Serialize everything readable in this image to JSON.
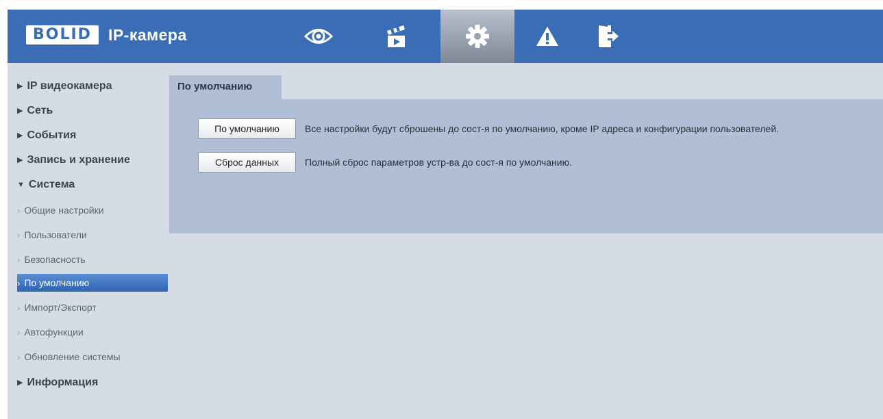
{
  "header": {
    "brand": "BOLID",
    "product": "IP-камера",
    "toolbar": [
      {
        "icon": "eye-icon",
        "active": false
      },
      {
        "icon": "clapperboard-icon",
        "active": false
      },
      {
        "icon": "gear-icon",
        "active": true
      },
      {
        "icon": "warning-icon",
        "active": false
      },
      {
        "icon": "logout-icon",
        "active": false
      }
    ]
  },
  "sidebar": {
    "items": [
      {
        "label": "IP видеокамера",
        "expanded": false
      },
      {
        "label": "Сеть",
        "expanded": false
      },
      {
        "label": "События",
        "expanded": false
      },
      {
        "label": "Запись и хранение",
        "expanded": false
      },
      {
        "label": "Система",
        "expanded": true
      },
      {
        "label": "Информация",
        "expanded": false
      }
    ],
    "arrow_collapsed": "▶",
    "arrow_expanded": "▼",
    "subitems": [
      {
        "label": "Общие настройки",
        "selected": false
      },
      {
        "label": "Пользователи",
        "selected": false
      },
      {
        "label": "Безопасность",
        "selected": false
      },
      {
        "label": "По умолчанию",
        "selected": true
      },
      {
        "label": "Импорт/Экспорт",
        "selected": false
      },
      {
        "label": "Автофункции",
        "selected": false
      },
      {
        "label": "Обновление системы",
        "selected": false
      }
    ],
    "chevron": "›"
  },
  "main": {
    "tab": "По умолчанию",
    "actions": [
      {
        "button": "По умолчанию",
        "description": "Все настройки будут сброшены до сост-я по умолчанию, кроме IP адреса и конфигурации пользователей."
      },
      {
        "button": "Сброс данных",
        "description": "Полный сброс параметров устр-ва до сост-я по умолчанию."
      }
    ]
  },
  "colors": {
    "header": "#3a6db5",
    "sidebar_bg": "#d6dce6",
    "panel": "#b0bfd6",
    "selected": "#2e63b0"
  }
}
